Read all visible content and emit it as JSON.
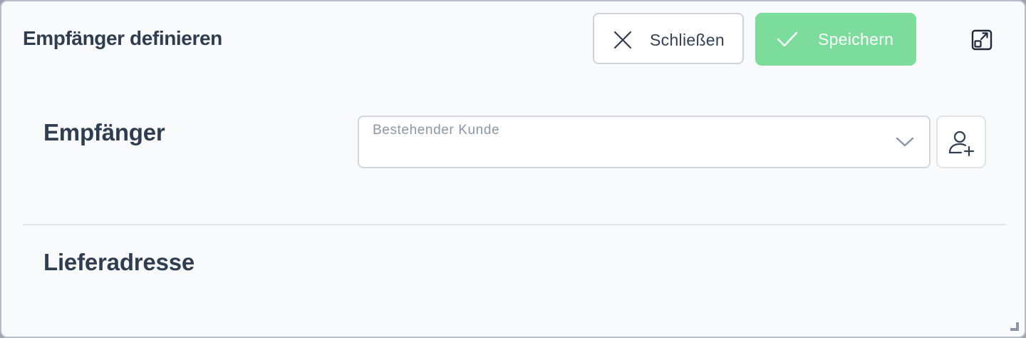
{
  "dialog": {
    "title": "Empfänger definieren"
  },
  "toolbar": {
    "close_label": "Schließen",
    "close_icon": "close-icon",
    "save_label": "Speichern",
    "save_icon": "check-icon",
    "expand_icon": "expand-icon",
    "save_color": "#7cdc9c"
  },
  "recipient_section": {
    "title": "Empfänger",
    "customer_select": {
      "placeholder": "Bestehender Kunde",
      "value": ""
    },
    "add_customer_icon": "add-user-icon"
  },
  "delivery_section": {
    "title": "Lieferadresse"
  }
}
